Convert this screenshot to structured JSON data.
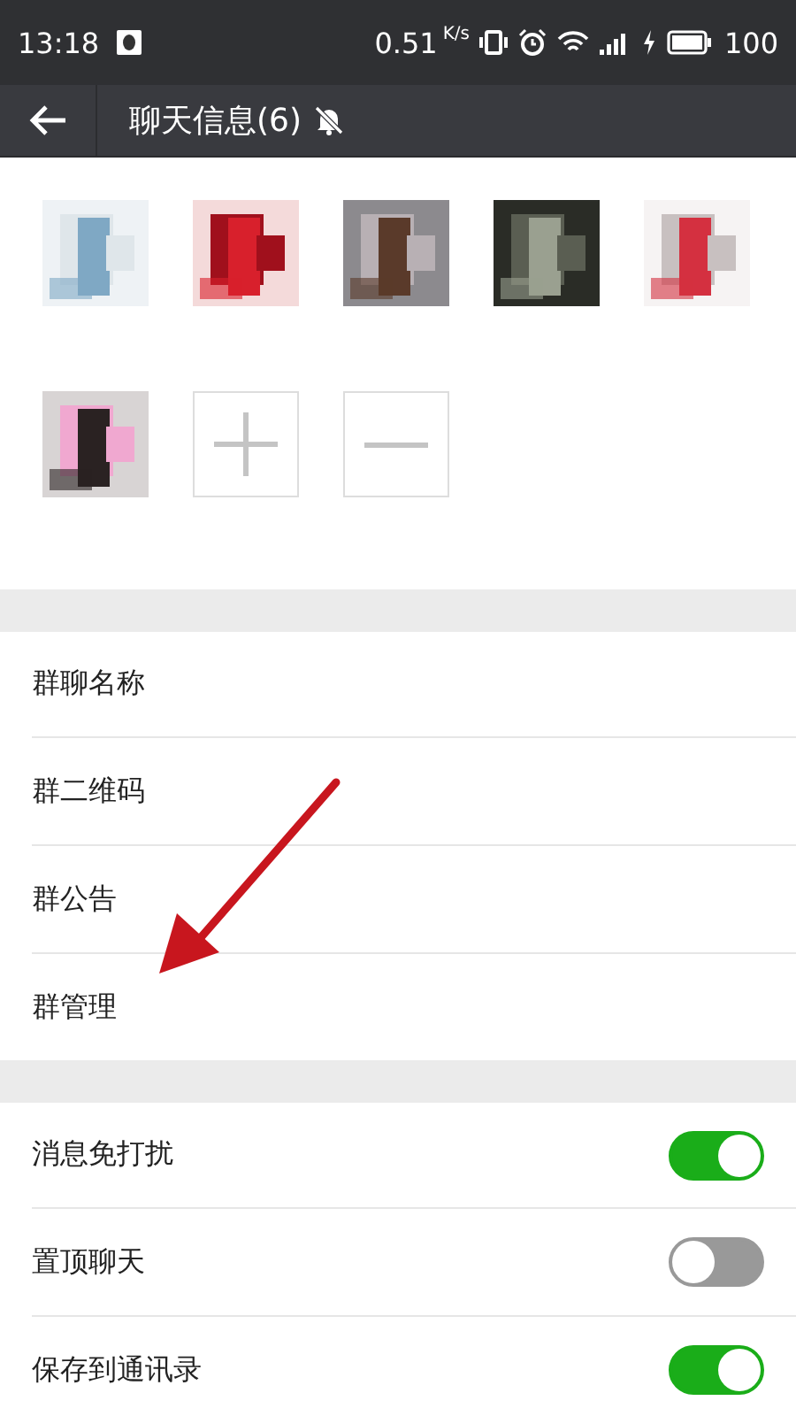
{
  "status_bar": {
    "time": "13:18",
    "speed": "0.51",
    "speed_unit": "K/s",
    "battery": "100"
  },
  "header": {
    "title": "聊天信息(6)",
    "muted": true
  },
  "member_actions": [
    {
      "kind": "add"
    },
    {
      "kind": "remove"
    }
  ],
  "info_rows": [
    {
      "label": "群聊名称"
    },
    {
      "label": "群二维码"
    },
    {
      "label": "群公告"
    },
    {
      "label": "群管理"
    }
  ],
  "toggle_rows": [
    {
      "label": "消息免打扰",
      "on": true
    },
    {
      "label": "置顶聊天",
      "on": false
    },
    {
      "label": "保存到通讯录",
      "on": true
    }
  ]
}
